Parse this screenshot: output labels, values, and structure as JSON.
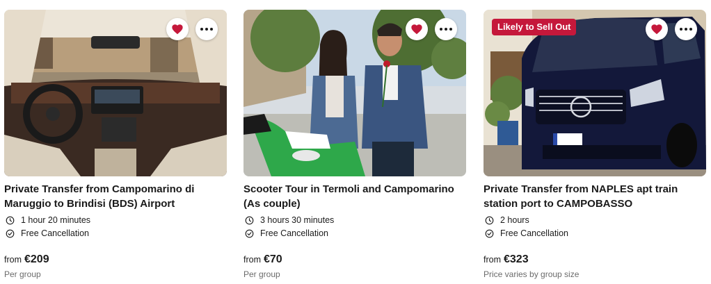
{
  "cards": [
    {
      "title": "Private Transfer from Campomarino di Maruggio to Brindisi (BDS) Airport",
      "duration": "1 hour 20 minutes",
      "cancellation": "Free Cancellation",
      "price_prefix": "from",
      "price": "€209",
      "price_note": "Per group",
      "image_subject": "car-interior-dashboard",
      "badge": ""
    },
    {
      "title": "Scooter Tour in Termoli and Campomarino (As couple)",
      "duration": "3 hours 30 minutes",
      "cancellation": "Free Cancellation",
      "price_prefix": "from",
      "price": "€70",
      "price_note": "Per group",
      "image_subject": "couple-with-green-scooter",
      "badge": ""
    },
    {
      "title": "Private Transfer from NAPLES apt train station port to CAMPOBASSO",
      "duration": "2 hours",
      "cancellation": "Free Cancellation",
      "price_prefix": "from",
      "price": "€323",
      "price_note": "Price varies by group size",
      "image_subject": "dark-blue-van",
      "badge": "Likely to Sell Out"
    }
  ],
  "colors": {
    "heart": "#c5183b",
    "badge_bg": "#c5183b",
    "muted_text": "#6b6b6b"
  },
  "icons": {
    "favorite": "heart-icon",
    "more": "more-options-icon",
    "duration": "clock-icon",
    "cancellation": "check-circle-icon"
  }
}
